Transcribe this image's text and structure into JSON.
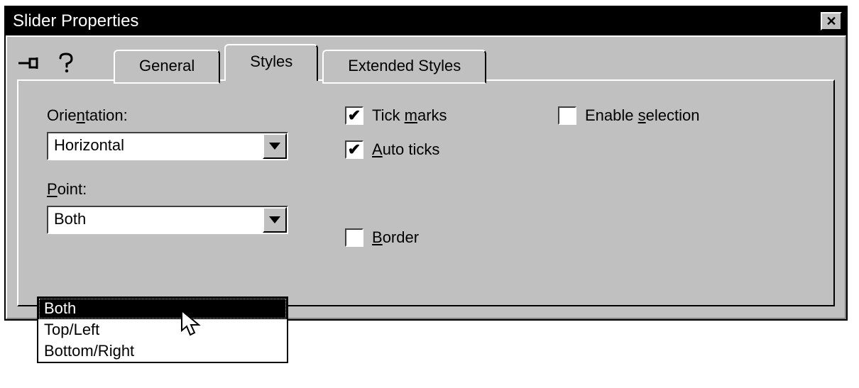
{
  "window": {
    "title": "Slider Properties"
  },
  "tabs": {
    "general": "General",
    "styles": "Styles",
    "extended": "Extended Styles"
  },
  "styles_panel": {
    "orientation_label_pre": "Orie",
    "orientation_label_u": "n",
    "orientation_label_post": "tation:",
    "orientation_value": "Horizontal",
    "point_label_u": "P",
    "point_label_post": "oint:",
    "point_value": "Both",
    "point_options": [
      "Both",
      "Top/Left",
      "Bottom/Right"
    ],
    "tick_marks_pre": "Tick ",
    "tick_marks_u": "m",
    "tick_marks_post": "arks",
    "tick_marks_checked": true,
    "auto_ticks_u": "A",
    "auto_ticks_post": "uto ticks",
    "auto_ticks_checked": true,
    "border_u": "B",
    "border_post": "order",
    "border_checked": false,
    "enable_sel_pre": "Enable ",
    "enable_sel_u": "s",
    "enable_sel_post": "election",
    "enable_sel_checked": false
  },
  "glyphs": {
    "check": "✔"
  }
}
